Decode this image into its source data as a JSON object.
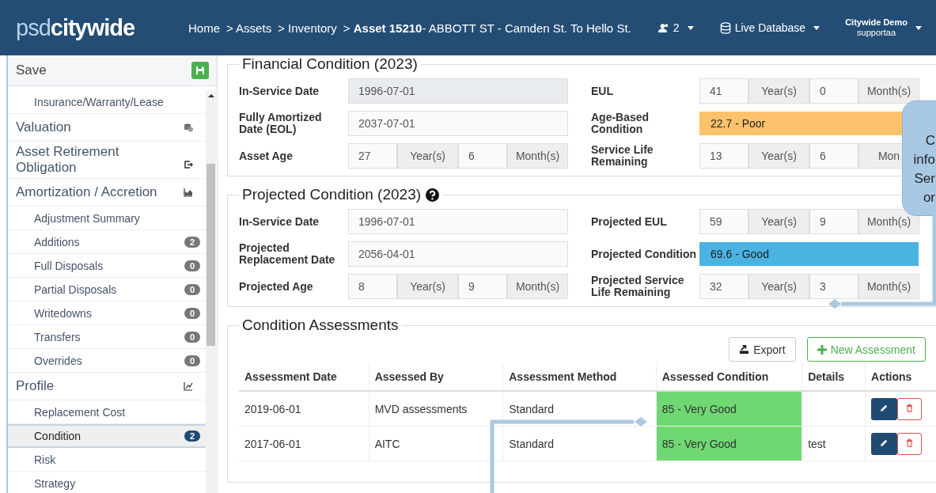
{
  "header": {
    "logo_light": "psd",
    "logo_bold": "citywide",
    "breadcrumbs": [
      "Home",
      "> Assets",
      "> Inventory",
      "> **Asset 15210**- ABBOTT ST - Camden St. To Hello St."
    ],
    "users_count": "2",
    "database": "Live Database",
    "user_name": "Citywide Demo",
    "user_id": "supportaa"
  },
  "sidebar": {
    "save": "Save",
    "items": [
      {
        "kind": "sub",
        "label": "Insurance/Warranty/Lease",
        "selected": false
      },
      {
        "kind": "section",
        "label": "Valuation",
        "selected": false
      },
      {
        "kind": "section",
        "label": "Asset Retirement Obligation",
        "selected": false
      },
      {
        "kind": "section",
        "label": "Amortization / Accretion",
        "selected": false
      },
      {
        "kind": "sub",
        "label": "Adjustment Summary",
        "selected": false
      },
      {
        "kind": "sub",
        "label": "Additions",
        "badge": "2",
        "selected": false
      },
      {
        "kind": "sub",
        "label": "Full Disposals",
        "badge": "0",
        "selected": false
      },
      {
        "kind": "sub",
        "label": "Partial Disposals",
        "badge": "0",
        "selected": false
      },
      {
        "kind": "sub",
        "label": "Writedowns",
        "badge": "0",
        "selected": false
      },
      {
        "kind": "sub",
        "label": "Transfers",
        "badge": "0",
        "selected": false
      },
      {
        "kind": "sub",
        "label": "Overrides",
        "badge": "0",
        "selected": false
      },
      {
        "kind": "section",
        "label": "Profile",
        "selected": false
      },
      {
        "kind": "sub",
        "label": "Replacement Cost",
        "selected": false
      },
      {
        "kind": "sub",
        "label": "Condition",
        "badge": "2",
        "selected": true
      },
      {
        "kind": "sub",
        "label": "Risk",
        "selected": false
      },
      {
        "kind": "sub",
        "label": "Strategy",
        "selected": false
      }
    ]
  },
  "financial_condition": {
    "title": "Financial Condition (2023)",
    "fields": [
      {
        "kind": "date",
        "label": "In-Service Date",
        "value": "1996-07-01",
        "disabled": true
      },
      {
        "kind": "duration",
        "label": "EUL",
        "years": "41",
        "years_unit": "Year(s)",
        "months": "0",
        "months_unit": "Month(s)"
      },
      {
        "kind": "date",
        "label": "Fully Amortized Date (EOL)",
        "value": "2037-07-01",
        "disabled": false
      },
      {
        "kind": "condition",
        "label": "Age-Based Condition",
        "value": "22.7 - Poor",
        "color": "#fdc26c"
      },
      {
        "kind": "duration",
        "label": "Asset Age",
        "years": "27",
        "years_unit": "Year(s)",
        "months": "6",
        "months_unit": "Month(s)"
      },
      {
        "kind": "duration",
        "label": "Service Life Remaining",
        "years": "13",
        "years_unit": "Year(s)",
        "months": "6",
        "months_unit": "Mon"
      }
    ]
  },
  "projected_condition": {
    "title": "Projected Condition (2023)",
    "fields": [
      {
        "kind": "date",
        "label": "In-Service Date",
        "value": "1996-07-01",
        "disabled": false
      },
      {
        "kind": "duration",
        "label": "Projected EUL",
        "years": "59",
        "years_unit": "Year(s)",
        "months": "9",
        "months_unit": "Month(s)"
      },
      {
        "kind": "date",
        "label": "Projected Replacement Date",
        "value": "2056-04-01",
        "disabled": false
      },
      {
        "kind": "condition",
        "label": "Projected Condition",
        "value": "69.6 - Good",
        "color": "#4ab3e2"
      },
      {
        "kind": "duration",
        "label": "Projected Age",
        "years": "8",
        "years_unit": "Year(s)",
        "months": "9",
        "months_unit": "Month(s)"
      },
      {
        "kind": "duration",
        "label": "Projected Service Life Remaining",
        "years": "32",
        "years_unit": "Year(s)",
        "months": "3",
        "months_unit": "Month(s)"
      }
    ]
  },
  "condition_assessments": {
    "title": "Condition Assessments",
    "export": "Export",
    "new_assessment": "New Assessment",
    "columns": [
      "Assessment Date",
      "Assessed By",
      "Assessment Method",
      "Assessed Condition",
      "Details",
      "Actions"
    ],
    "rows": [
      {
        "date": "2019-06-01",
        "assessed_by": "MVD assessments",
        "method": "Standard",
        "condition": "85 - Very Good",
        "color": "#6fd873"
      },
      {
        "date": "2017-06-01",
        "assessed_by": "AITC",
        "method": "Standard",
        "condition": "85 - Very Good",
        "color": "#6fd873",
        "details": "test"
      }
    ]
  },
  "callout": {
    "lines": [
      "C",
      "info",
      "Ser",
      "or"
    ]
  }
}
